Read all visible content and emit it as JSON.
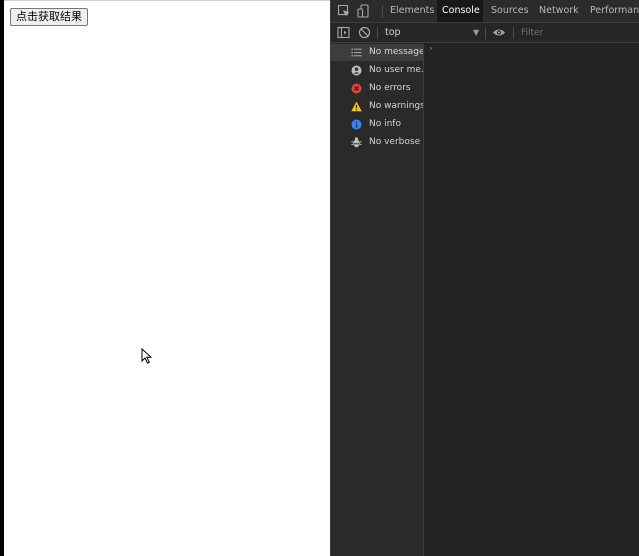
{
  "page": {
    "button_label": "点击获取结果"
  },
  "devtools": {
    "tabs": [
      "Elements",
      "Console",
      "Sources",
      "Network",
      "Performance"
    ],
    "active_tab": "Console",
    "toolbar": {
      "context": "top",
      "filter_placeholder": "Filter"
    },
    "sidebar": {
      "items": [
        {
          "label": "No messages",
          "icon": "list-icon",
          "color": "#9aa0a6"
        },
        {
          "label": "No user me...",
          "icon": "user-icon",
          "color": "#bdbdbd"
        },
        {
          "label": "No errors",
          "icon": "error-icon",
          "color": "#e4403c"
        },
        {
          "label": "No warnings",
          "icon": "warning-icon",
          "color": "#f5c518"
        },
        {
          "label": "No info",
          "icon": "info-icon",
          "color": "#3b82f6"
        },
        {
          "label": "No verbose",
          "icon": "bug-icon",
          "color": "#bdbdbd"
        }
      ]
    },
    "colors": {
      "panel_bg": "#242424",
      "prompt_accent": "#4d8df5"
    }
  }
}
